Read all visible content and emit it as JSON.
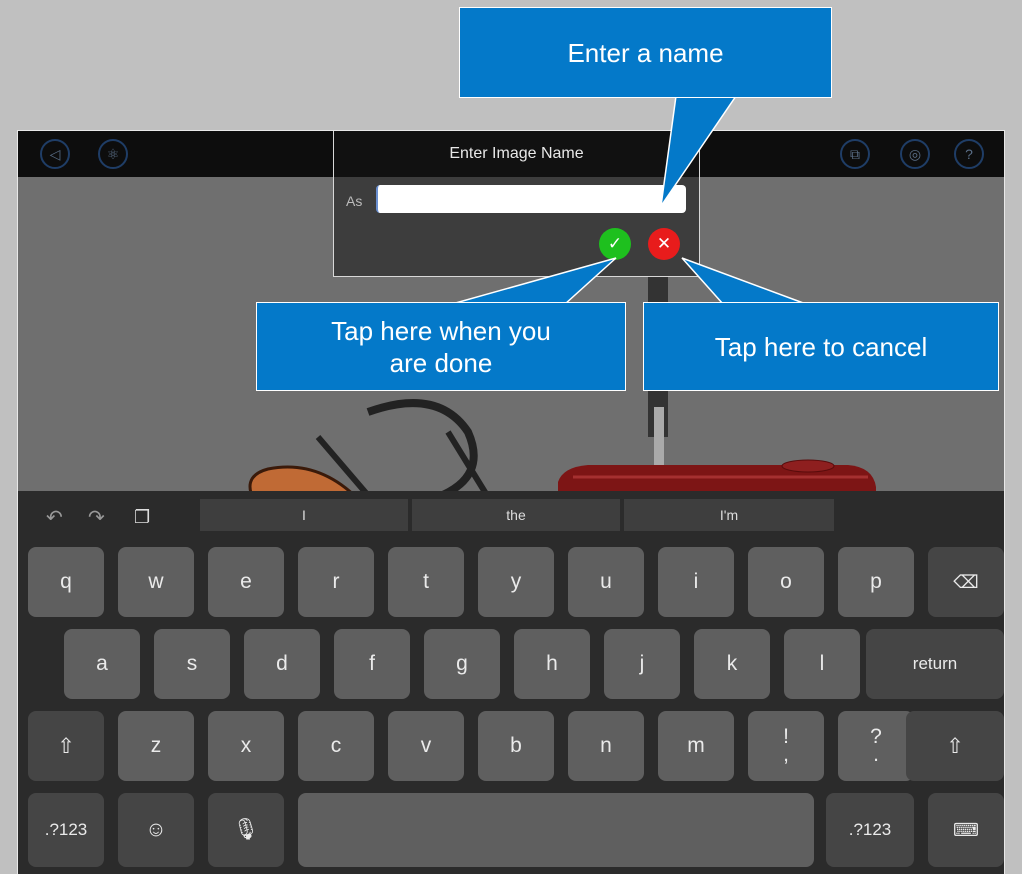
{
  "topbar": {
    "back_icon": "triangle-left-icon",
    "atom_icon": "atom-icon",
    "share_icon": "external-window-icon",
    "settings_icon": "target-icon",
    "help_label": "?"
  },
  "dialog": {
    "title": "Enter Image Name",
    "as_label": "As",
    "input_value": "",
    "confirm_icon": "checkmark-icon",
    "cancel_icon": "x-icon",
    "confirm_color": "#1ec01e",
    "cancel_color": "#e81c1c"
  },
  "callouts": {
    "enter_name": "Enter a name",
    "done": "Tap here when you are done",
    "done_line1": "Tap here when you",
    "done_line2": "are done",
    "cancel": "Tap here to cancel",
    "color": "#0479c9"
  },
  "keyboard": {
    "suggestions": [
      "I",
      "the",
      "I'm"
    ],
    "row1": [
      "q",
      "w",
      "e",
      "r",
      "t",
      "y",
      "u",
      "i",
      "o",
      "p"
    ],
    "row2": [
      "a",
      "s",
      "d",
      "f",
      "g",
      "h",
      "j",
      "k",
      "l"
    ],
    "row3": [
      "z",
      "x",
      "c",
      "v",
      "b",
      "n",
      "m"
    ],
    "return_label": "return",
    "numbers_label": ".?123",
    "excl_top": "!",
    "excl_bottom": ",",
    "quest_top": "?",
    "quest_bottom": "."
  }
}
